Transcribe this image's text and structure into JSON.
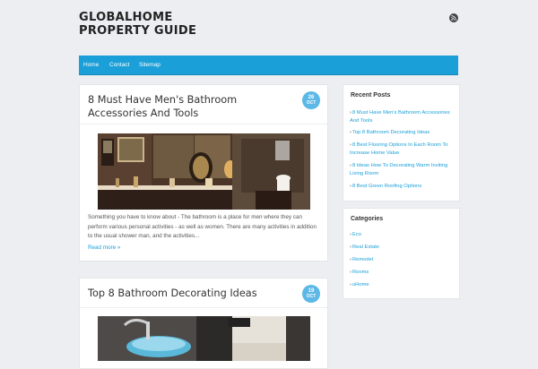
{
  "site": {
    "title_line1": "GLOBALHOME",
    "title_line2": "PROPERTY GUIDE",
    "rss_icon": "rss-icon"
  },
  "nav": {
    "items": [
      {
        "label": "Home"
      },
      {
        "label": "Contact"
      },
      {
        "label": "Sitemap"
      }
    ]
  },
  "posts": [
    {
      "title": "8 Must Have Men's Bathroom Accessories And Tools",
      "date_day": "26",
      "date_month": "OCT",
      "excerpt": "Something you have to know about - The bathroom is a place for men where they can perform various personal activities - as well as women. There are many activities in addition to the usual shower man, and the activities...",
      "read_more": "Read more »"
    },
    {
      "title": "Top 8 Bathroom Decorating Ideas",
      "date_day": "19",
      "date_month": "OCT"
    }
  ],
  "sidebar": {
    "recent_posts": {
      "title": "Recent Posts",
      "items": [
        "8 Must Have Men's Bathroom Accessories And Tools",
        "Top 8 Bathroom Decorating Ideas",
        "8 Best Flooring Options In Each Room To Increase Home Value",
        "8 Ideas How To Decorating Warm Inviting Living Room",
        "8 Best Green Roofing Options"
      ]
    },
    "categories": {
      "title": "Categories",
      "items": [
        "Eco",
        "Real Estate",
        "Remodel",
        "Rooms",
        "uHome"
      ]
    }
  }
}
